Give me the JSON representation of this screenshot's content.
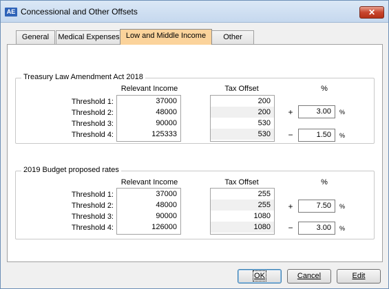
{
  "window": {
    "title": "Concessional and Other Offsets",
    "app_icon_text": "AE",
    "close_glyph": "✕"
  },
  "tabs": [
    {
      "label": "General",
      "active": false
    },
    {
      "label": "Medical Expenses",
      "active": false
    },
    {
      "label": "Low and Middle Income",
      "active": true
    },
    {
      "label": "Other",
      "active": false
    }
  ],
  "col_headers": {
    "income": "Relevant Income",
    "offset": "Tax Offset",
    "pct": "%"
  },
  "groups": [
    {
      "title": "Treasury Law Amendment Act 2018",
      "rows": [
        {
          "label": "Threshold 1:",
          "income": "37000",
          "offset": "200"
        },
        {
          "label": "Threshold 2:",
          "income": "48000",
          "offset": "200"
        },
        {
          "label": "Threshold 3:",
          "income": "90000",
          "offset": "530"
        },
        {
          "label": "Threshold 4:",
          "income": "125333",
          "offset": "530"
        }
      ],
      "plus_sign": "+",
      "plus_value": "3.00",
      "minus_sign": "−",
      "minus_value": "1.50",
      "pct_symbol": "%"
    },
    {
      "title": "2019 Budget proposed rates",
      "rows": [
        {
          "label": "Threshold 1:",
          "income": "37000",
          "offset": "255"
        },
        {
          "label": "Threshold 2:",
          "income": "48000",
          "offset": "255"
        },
        {
          "label": "Threshold 3:",
          "income": "90000",
          "offset": "1080"
        },
        {
          "label": "Threshold 4:",
          "income": "126000",
          "offset": "1080"
        }
      ],
      "plus_sign": "+",
      "plus_value": "7.50",
      "minus_sign": "−",
      "minus_value": "3.00",
      "pct_symbol": "%"
    }
  ],
  "buttons": {
    "ok": "OK",
    "cancel": "Cancel",
    "edit": "Edit"
  }
}
